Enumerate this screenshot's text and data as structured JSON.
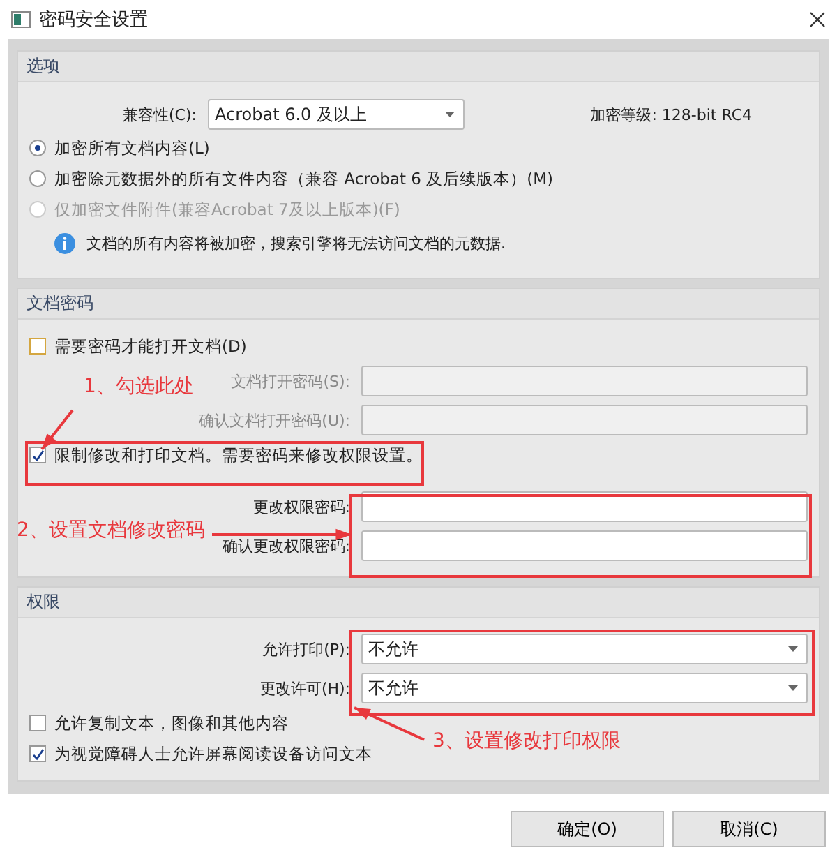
{
  "window": {
    "title": "密码安全设置"
  },
  "options": {
    "title": "选项",
    "compatibility": {
      "label": "兼容性(C):",
      "value": "Acrobat 6.0 及以上"
    },
    "encryption_level": "加密等级: 128-bit RC4",
    "radios": [
      {
        "label": "加密所有文档内容(L)",
        "selected": true,
        "disabled": false
      },
      {
        "label": "加密除元数据外的所有文件内容（兼容 Acrobat 6 及后续版本）(M)",
        "selected": false,
        "disabled": false
      },
      {
        "label": "仅加密文件附件(兼容Acrobat 7及以上版本)(F)",
        "selected": false,
        "disabled": true
      }
    ],
    "info": "文档的所有内容将被加密，搜索引擎将无法访问文档的元数据."
  },
  "doc_password": {
    "title": "文档密码",
    "require_open": {
      "label": "需要密码才能打开文档(D)",
      "checked": false
    },
    "open_fields": [
      {
        "label": "文档打开密码(S):",
        "disabled": true
      },
      {
        "label": "确认文档打开密码(U):",
        "disabled": true
      }
    ],
    "restrict": {
      "label": "限制修改和打印文档。需要密码来修改权限设置。",
      "checked": true
    },
    "perm_fields": [
      {
        "label": "更改权限密码:",
        "disabled": false
      },
      {
        "label": "确认更改权限密码:",
        "disabled": false
      }
    ]
  },
  "permissions": {
    "title": "权限",
    "selects": [
      {
        "label": "允许打印(P):",
        "value": "不允许"
      },
      {
        "label": "更改许可(H):",
        "value": "不允许"
      }
    ],
    "checkboxes": [
      {
        "label": "允许复制文本，图像和其他内容",
        "checked": false
      },
      {
        "label": "为视觉障碍人士允许屏幕阅读设备访问文本",
        "checked": true
      }
    ]
  },
  "buttons": [
    {
      "label": "确定(O)"
    },
    {
      "label": "取消(C)"
    }
  ],
  "annotations": [
    {
      "text": "1、勾选此处"
    },
    {
      "text": "2、设置文档修改密码"
    },
    {
      "text": "3、设置修改打印权限"
    }
  ]
}
